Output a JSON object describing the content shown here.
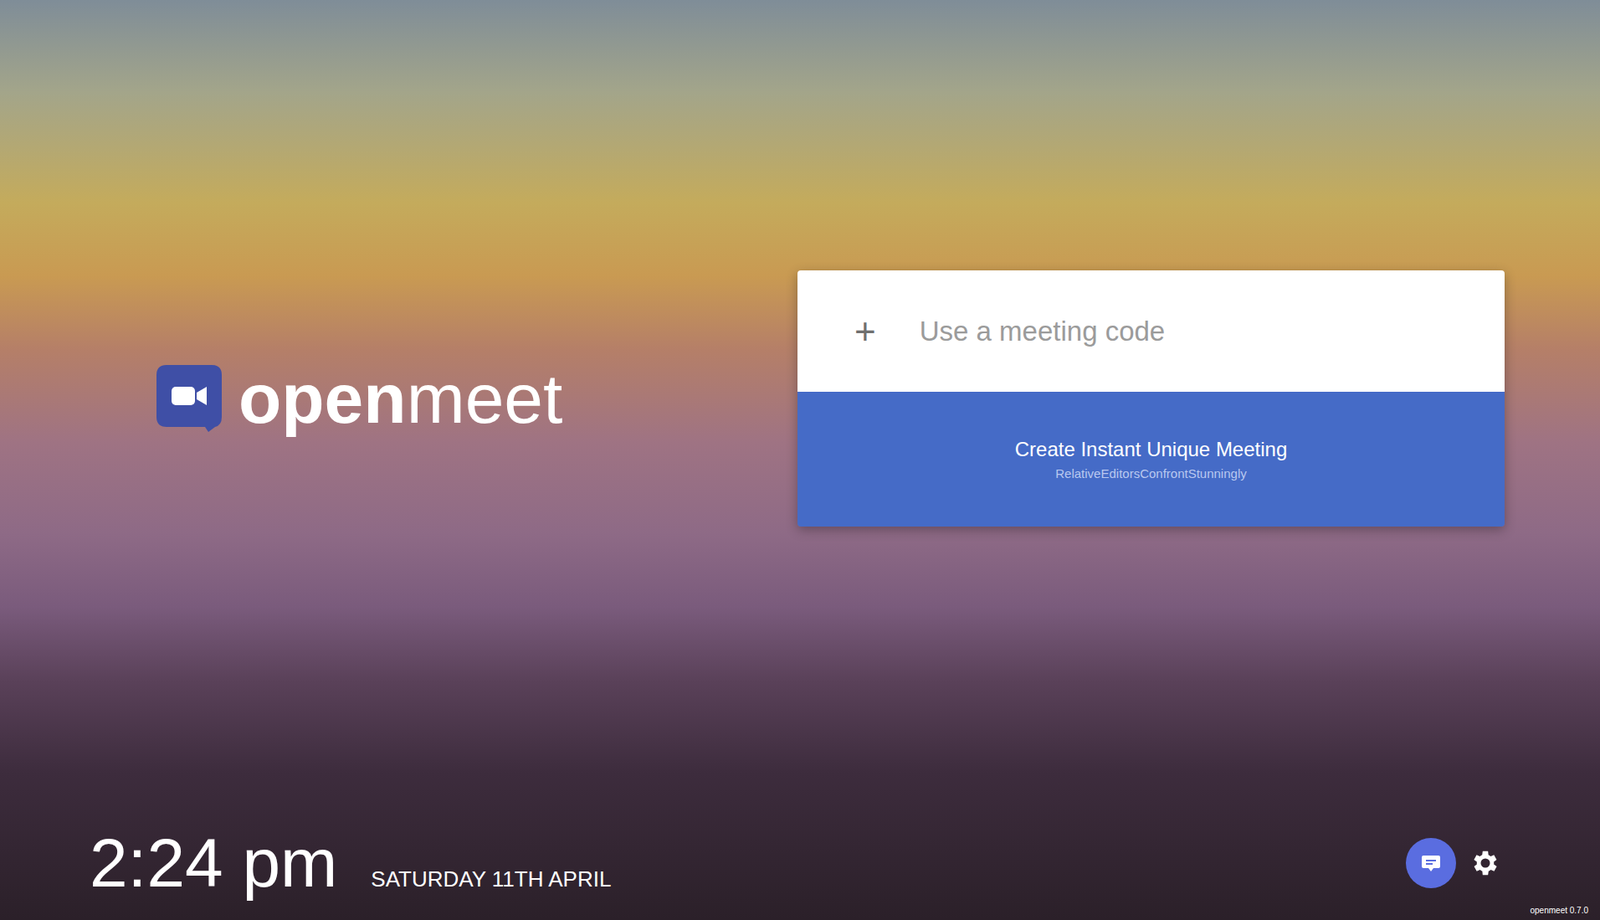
{
  "brand": {
    "name_bold": "open",
    "name_light": "meet"
  },
  "meeting_code": {
    "icon": "+",
    "placeholder": "Use a meeting code"
  },
  "create_meeting": {
    "label": "Create Instant Unique Meeting",
    "code": "RelativeEditorsConfrontStunningly"
  },
  "clock": {
    "time": "2:24 pm",
    "date": "SATURDAY 11TH APRIL"
  },
  "version": "openmeet 0.7.0"
}
